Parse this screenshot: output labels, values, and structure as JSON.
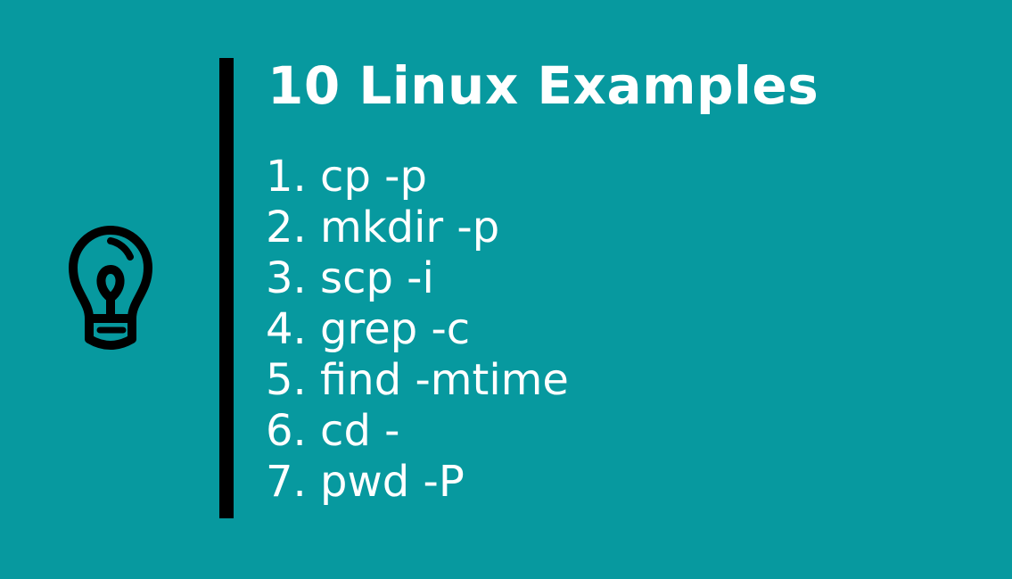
{
  "title": "10 Linux Examples",
  "items": [
    "1. cp -p",
    "2. mkdir -p",
    "3. scp -i",
    "4. grep -c",
    "5. find -mtime",
    "6. cd -",
    "7. pwd -P"
  ],
  "icon": "lightbulb-icon",
  "colors": {
    "background": "#07999f",
    "text": "#ffffff",
    "accent_bar": "#000000"
  }
}
